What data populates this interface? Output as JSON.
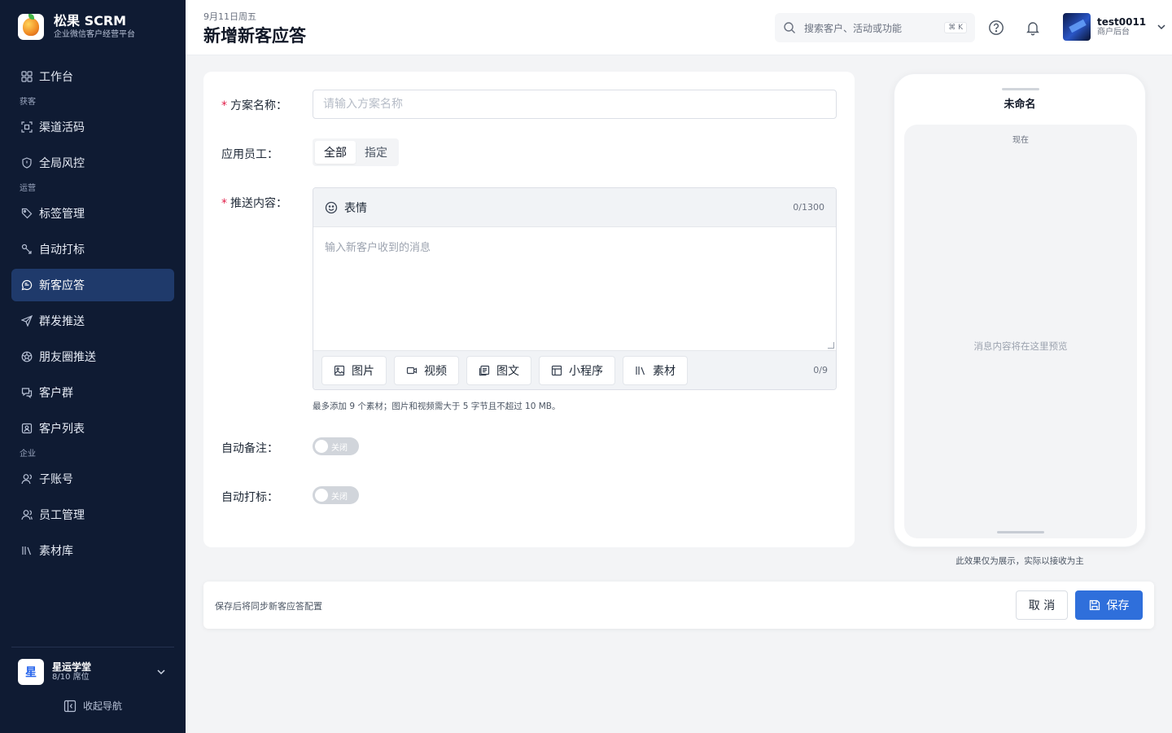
{
  "brand": {
    "title": "松果 SCRM",
    "subtitle": "企业微信客户经营平台"
  },
  "sidebar": {
    "items": [
      {
        "label": "工作台",
        "icon": "grid-icon"
      },
      {
        "group": "获客"
      },
      {
        "label": "渠道活码",
        "icon": "qrcode-icon"
      },
      {
        "label": "全局风控",
        "icon": "shield-icon"
      },
      {
        "group": "运营"
      },
      {
        "label": "标签管理",
        "icon": "tag-icon"
      },
      {
        "label": "自动打标",
        "icon": "auto-tag-icon"
      },
      {
        "label": "新客应答",
        "icon": "chat-icon",
        "active": true
      },
      {
        "label": "群发推送",
        "icon": "send-icon"
      },
      {
        "label": "朋友圈推送",
        "icon": "moments-icon"
      },
      {
        "label": "客户群",
        "icon": "group-chat-icon"
      },
      {
        "label": "客户列表",
        "icon": "contacts-icon"
      },
      {
        "group": "企业"
      },
      {
        "label": "子账号",
        "icon": "user-icon"
      },
      {
        "label": "员工管理",
        "icon": "users-icon"
      },
      {
        "label": "素材库",
        "icon": "library-icon"
      }
    ],
    "workspace": {
      "badge": "星",
      "name": "星运学堂",
      "seats": "8/10 席位"
    },
    "collapse_label": "收起导航"
  },
  "header": {
    "date": "9月11日周五",
    "title": "新增新客应答",
    "search_placeholder": "搜索客户、活动或功能",
    "search_shortcut": "⌘ K",
    "user": {
      "name": "test0011",
      "role": "商户后台"
    }
  },
  "form": {
    "name_label": "方案名称：",
    "name_placeholder": "请输入方案名称",
    "staff_label": "应用员工：",
    "staff_options": [
      "全部",
      "指定"
    ],
    "staff_selected": "全部",
    "content_label": "推送内容：",
    "emoji_label": "表情",
    "char_count": "0/1300",
    "message_placeholder": "输入新客户收到的消息",
    "attachments": [
      {
        "label": "图片",
        "icon": "image-icon"
      },
      {
        "label": "视频",
        "icon": "video-icon"
      },
      {
        "label": "图文",
        "icon": "article-icon"
      },
      {
        "label": "小程序",
        "icon": "miniprogram-icon"
      },
      {
        "label": "素材",
        "icon": "library-icon"
      }
    ],
    "attachment_count": "0/9",
    "attachment_hint": "最多添加 9 个素材；图片和视频需大于 5 字节且不超过 10 MB。",
    "auto_remark_label": "自动备注：",
    "auto_tag_label": "自动打标：",
    "toggle_off": "关闭"
  },
  "preview": {
    "title": "未命名",
    "time": "现在",
    "empty": "消息内容将在这里预览",
    "note": "此效果仅为展示，实际以接收为主"
  },
  "footer": {
    "tip": "保存后将同步新客应答配置",
    "cancel": "取 消",
    "save": "保存"
  },
  "colors": {
    "sidebar_bg": "#0f1b33",
    "active_nav": "#1f3a6b",
    "primary": "#2f6fdb",
    "required": "#e11d48"
  }
}
